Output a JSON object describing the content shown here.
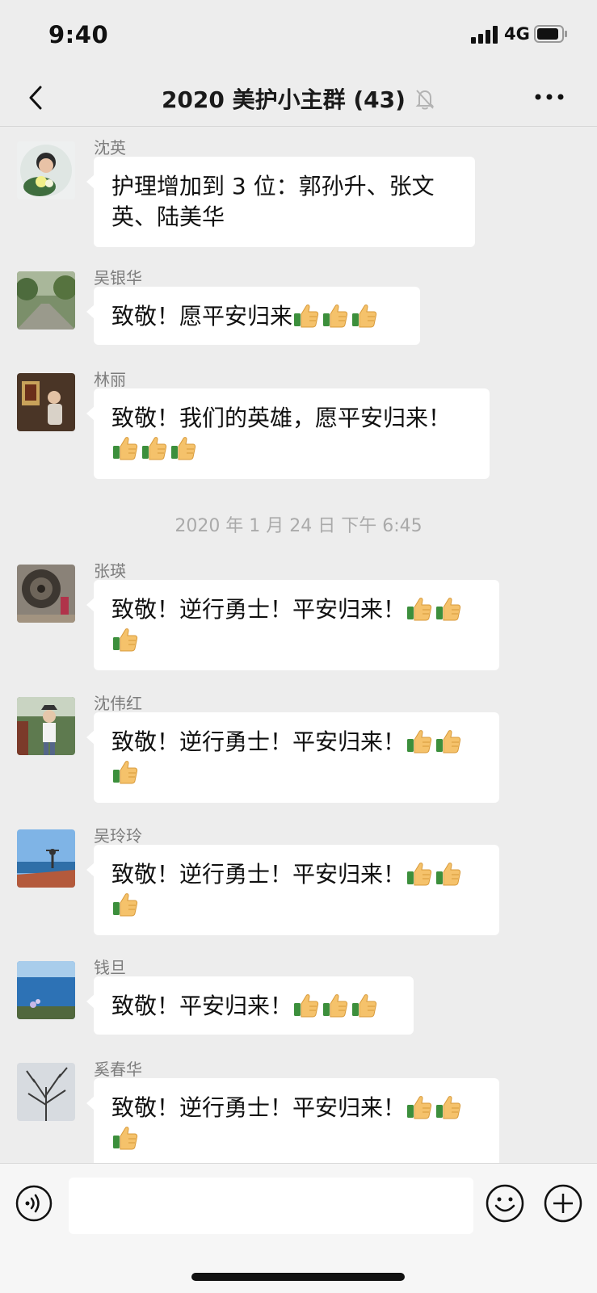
{
  "status_bar": {
    "time": "9:40",
    "network": "4G"
  },
  "nav": {
    "title": "2020 美护小主群 (43)"
  },
  "messages": [
    {
      "sender": "沈英",
      "text": "护理增加到 3 位：郭孙升、张文英、陆美华",
      "thumbs": 0
    },
    {
      "sender": "吴银华",
      "text": "致敬！愿平安归来",
      "thumbs": 3
    },
    {
      "sender": "林丽",
      "text": "致敬！我们的英雄，愿平安归来！",
      "thumbs": 3
    },
    {
      "sender": "张瑛",
      "text": "致敬！逆行勇士！平安归来！",
      "thumbs": 3
    },
    {
      "sender": "沈伟红",
      "text": "致敬！逆行勇士！平安归来！",
      "thumbs": 3
    },
    {
      "sender": "吴玲玲",
      "text": "致敬！逆行勇士！平安归来！",
      "thumbs": 3
    },
    {
      "sender": "钱旦",
      "text": "致敬！平安归来！",
      "thumbs": 3
    },
    {
      "sender": "奚春华",
      "text": "致敬！逆行勇士！平安归来！",
      "thumbs": 3
    }
  ],
  "timestamp": "2020 年 1 月 24 日 下午 6:45",
  "icons": {
    "back": "chevron-left-icon",
    "mute": "muted-bell-icon",
    "more": "more-dots-icon",
    "voice": "voice-icon",
    "emoji": "emoji-icon",
    "plus": "plus-icon",
    "thumbs": "thumbs-up-icon"
  }
}
